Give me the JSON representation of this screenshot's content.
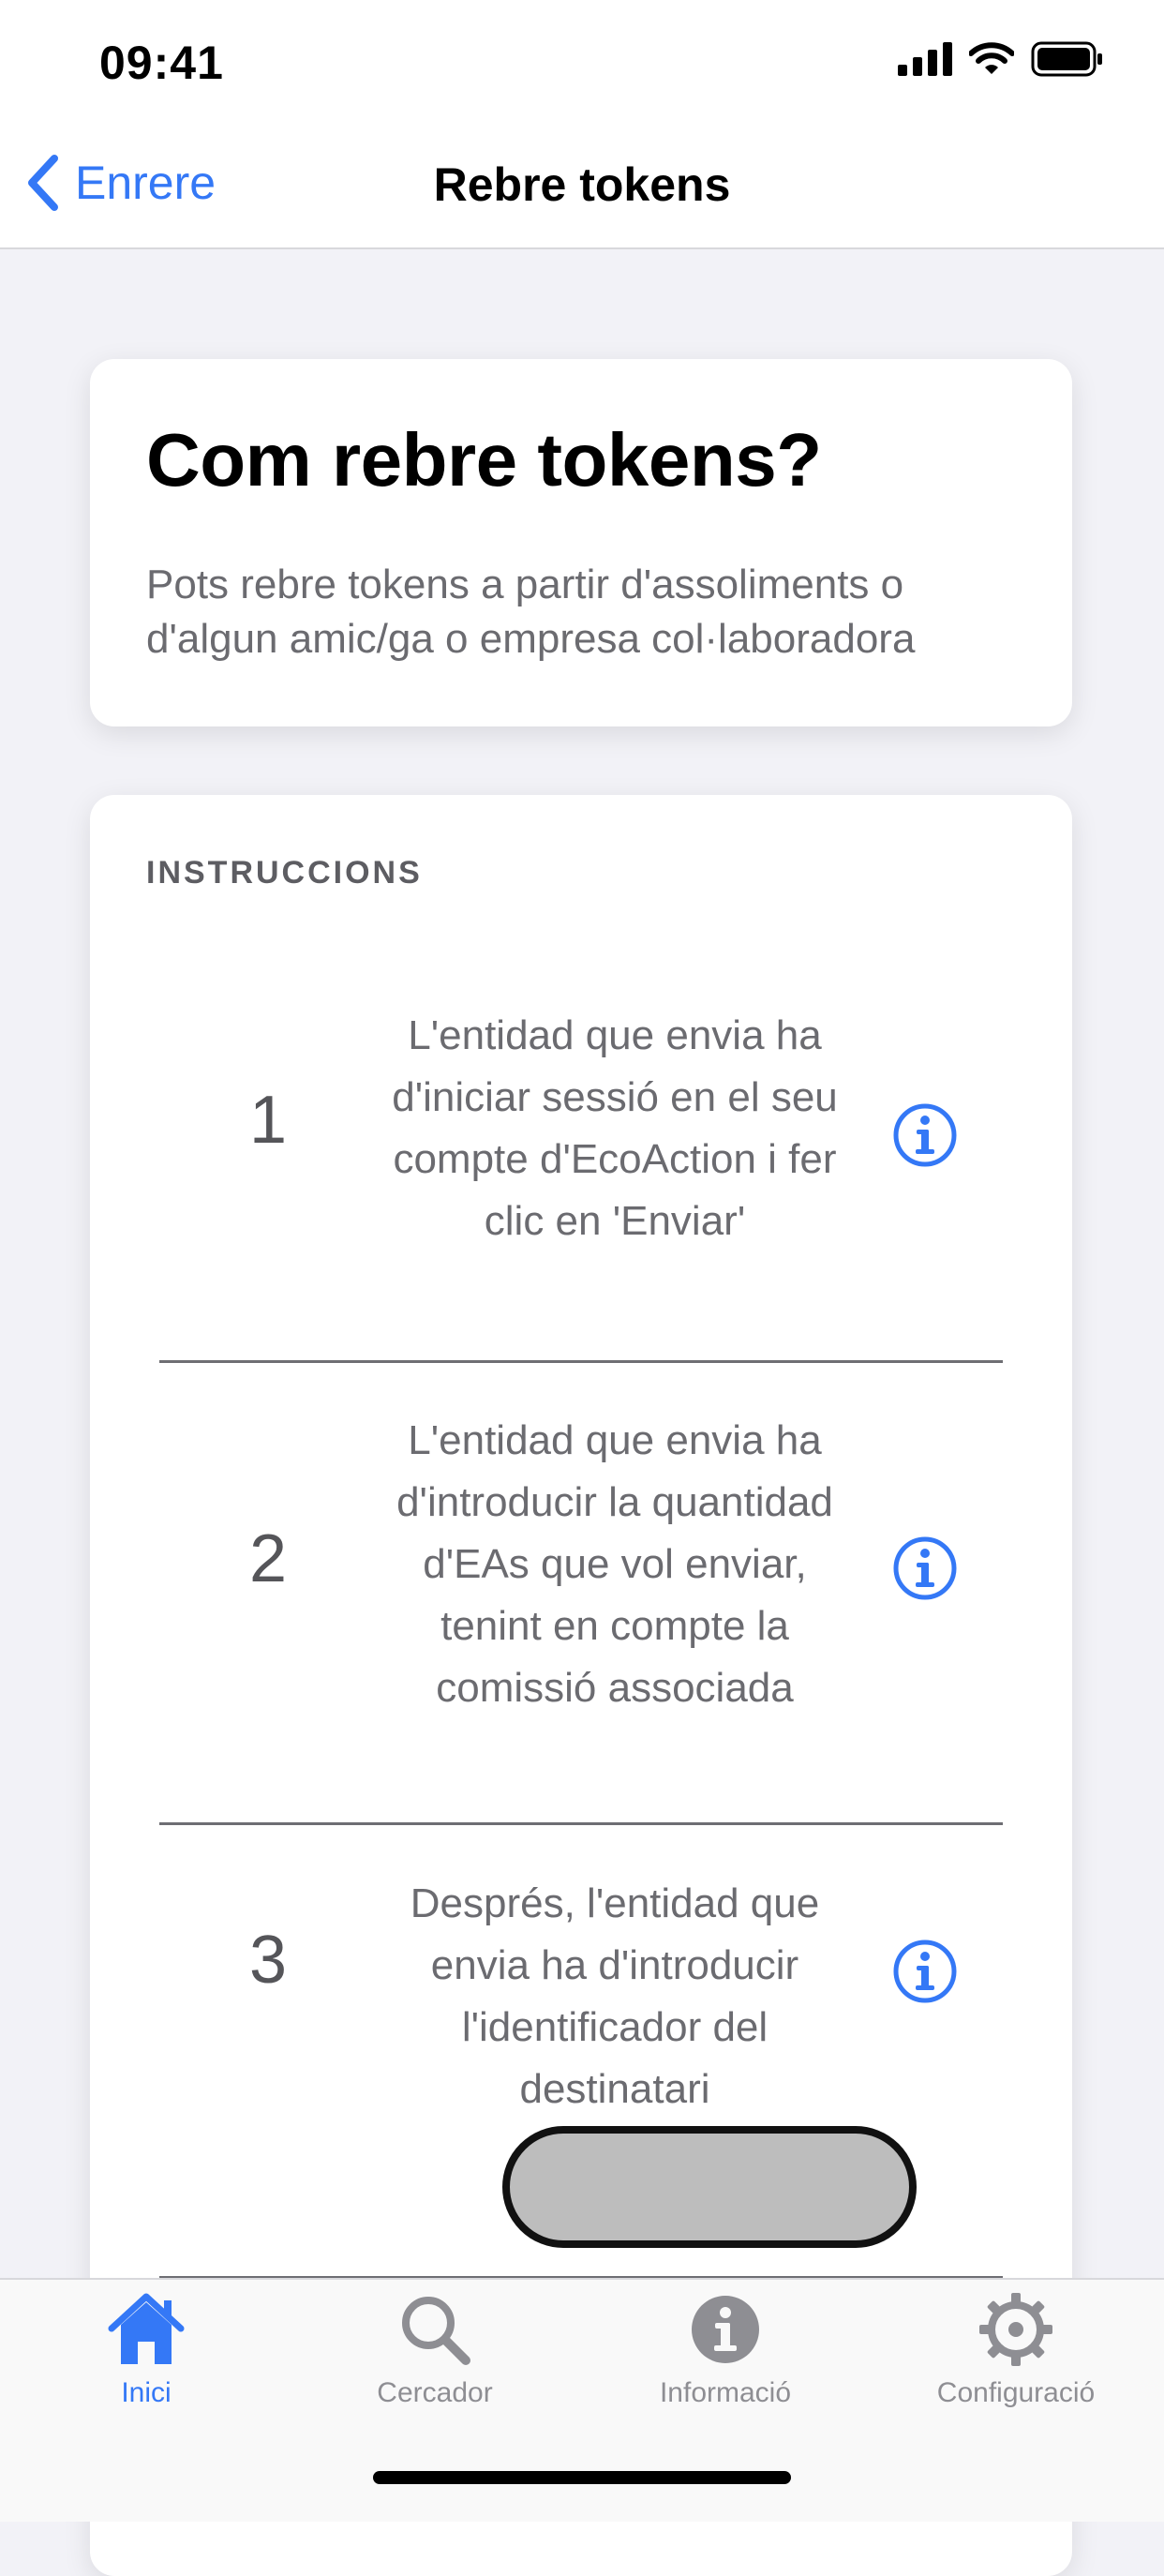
{
  "status_bar": {
    "time": "09:41"
  },
  "nav": {
    "back_label": "Enrere",
    "title": "Rebre tokens"
  },
  "intro": {
    "title": "Com rebre tokens?",
    "text": "Pots rebre tokens a partir d'assoliments o d'algun amic/ga o empresa col·laboradora"
  },
  "instructions": {
    "section_label": "INSTRUCCIONS",
    "steps": [
      {
        "number": "1",
        "text": "L'entidad que envia ha d'iniciar sessió en el seu compte d'EcoAction i fer clic en 'Enviar'"
      },
      {
        "number": "2",
        "text": "L'entidad que envia ha d'introducir la quantidad d'EAs que vol enviar, tenint en compte la comissió associada"
      },
      {
        "number": "3",
        "text": "Després, l'entidad que envia ha d'introducir l'identificador del destinatari"
      }
    ]
  },
  "tabs": [
    {
      "label": "Inici",
      "icon": "house-icon",
      "active": true
    },
    {
      "label": "Cercador",
      "icon": "search-icon",
      "active": false
    },
    {
      "label": "Informació",
      "icon": "info-icon",
      "active": false
    },
    {
      "label": "Configuració",
      "icon": "gear-icon",
      "active": false
    }
  ],
  "colors": {
    "accent": "#3478f6",
    "inactive": "#8e8e93",
    "background": "#f2f2f7"
  }
}
